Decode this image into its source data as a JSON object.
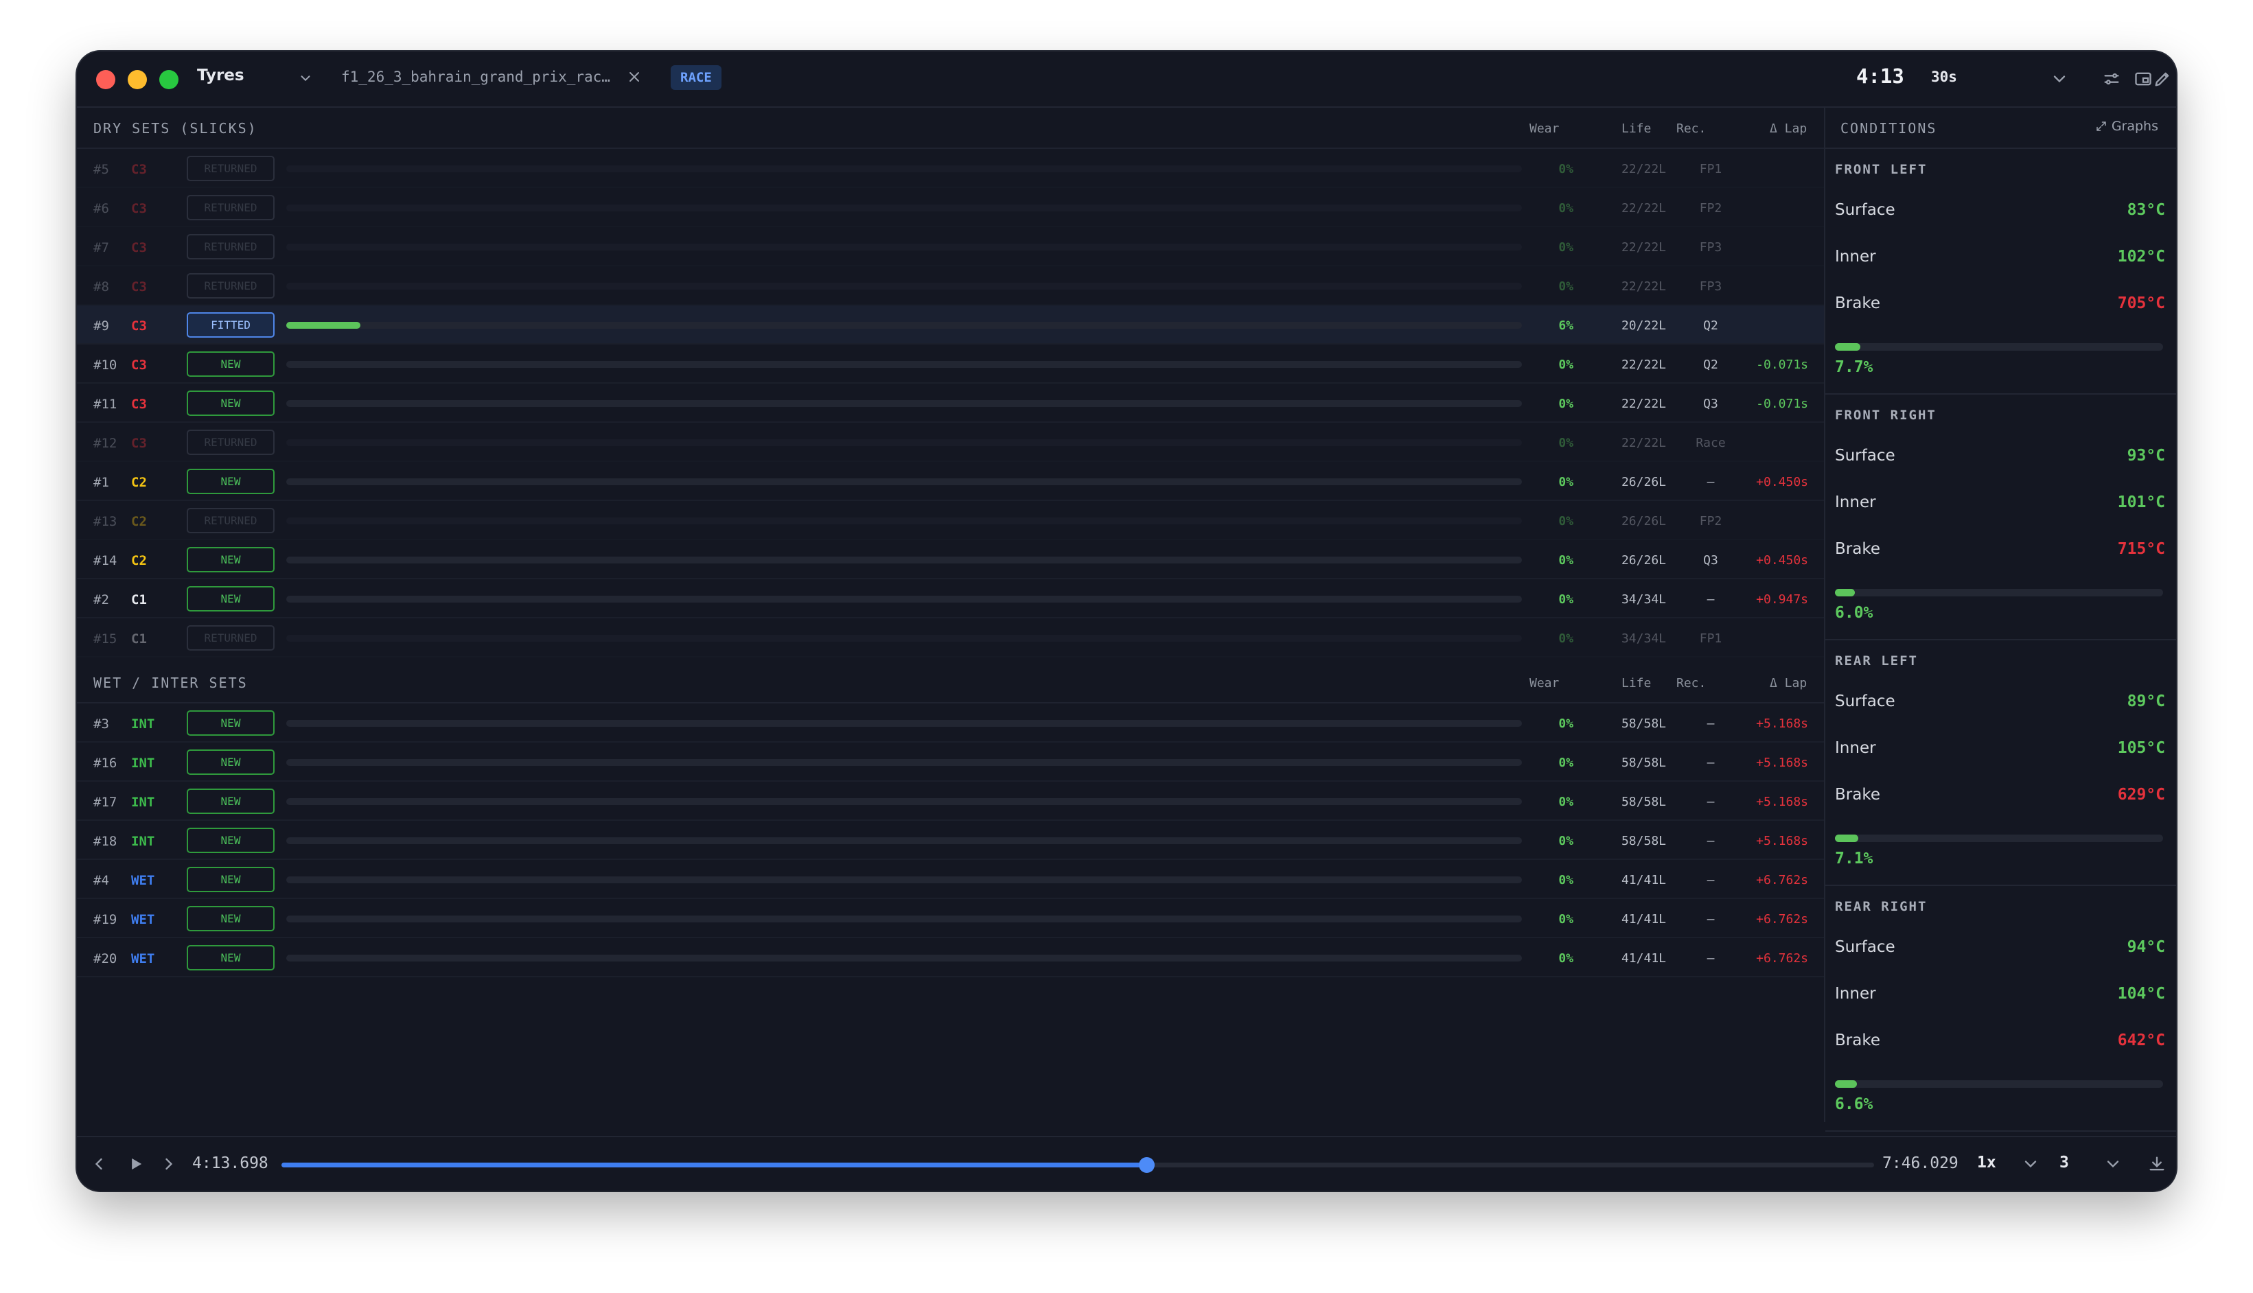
{
  "titlebar": {
    "app_title": "Tyres",
    "file_name": "f1_26_3_bahrain_grand_prix_rac…",
    "session_badge": "RACE",
    "clock": "4:13",
    "interval": "30s"
  },
  "columns": {
    "wear": "Wear",
    "life": "Life",
    "rec": "Rec.",
    "delta": "Δ Lap"
  },
  "dry": {
    "title": "DRY SETS (SLICKS)",
    "rows": [
      {
        "id": "#5",
        "compound": "C3",
        "status": "RETURNED",
        "wear": "0%",
        "life": "22/22L",
        "rec": "FP1",
        "delta": "",
        "wear_fraction": 0
      },
      {
        "id": "#6",
        "compound": "C3",
        "status": "RETURNED",
        "wear": "0%",
        "life": "22/22L",
        "rec": "FP2",
        "delta": "",
        "wear_fraction": 0
      },
      {
        "id": "#7",
        "compound": "C3",
        "status": "RETURNED",
        "wear": "0%",
        "life": "22/22L",
        "rec": "FP3",
        "delta": "",
        "wear_fraction": 0
      },
      {
        "id": "#8",
        "compound": "C3",
        "status": "RETURNED",
        "wear": "0%",
        "life": "22/22L",
        "rec": "FP3",
        "delta": "",
        "wear_fraction": 0
      },
      {
        "id": "#9",
        "compound": "C3",
        "status": "FITTED",
        "wear": "6%",
        "life": "20/22L",
        "rec": "Q2",
        "delta": "",
        "wear_fraction": 0.06
      },
      {
        "id": "#10",
        "compound": "C3",
        "status": "NEW",
        "wear": "0%",
        "life": "22/22L",
        "rec": "Q2",
        "delta": "-0.071s",
        "wear_fraction": 0
      },
      {
        "id": "#11",
        "compound": "C3",
        "status": "NEW",
        "wear": "0%",
        "life": "22/22L",
        "rec": "Q3",
        "delta": "-0.071s",
        "wear_fraction": 0
      },
      {
        "id": "#12",
        "compound": "C3",
        "status": "RETURNED",
        "wear": "0%",
        "life": "22/22L",
        "rec": "Race",
        "delta": "",
        "wear_fraction": 0
      },
      {
        "id": "#1",
        "compound": "C2",
        "status": "NEW",
        "wear": "0%",
        "life": "26/26L",
        "rec": "—",
        "delta": "+0.450s",
        "wear_fraction": 0
      },
      {
        "id": "#13",
        "compound": "C2",
        "status": "RETURNED",
        "wear": "0%",
        "life": "26/26L",
        "rec": "FP2",
        "delta": "",
        "wear_fraction": 0
      },
      {
        "id": "#14",
        "compound": "C2",
        "status": "NEW",
        "wear": "0%",
        "life": "26/26L",
        "rec": "Q3",
        "delta": "+0.450s",
        "wear_fraction": 0
      },
      {
        "id": "#2",
        "compound": "C1",
        "status": "NEW",
        "wear": "0%",
        "life": "34/34L",
        "rec": "—",
        "delta": "+0.947s",
        "wear_fraction": 0
      },
      {
        "id": "#15",
        "compound": "C1",
        "status": "RETURNED",
        "wear": "0%",
        "life": "34/34L",
        "rec": "FP1",
        "delta": "",
        "wear_fraction": 0
      }
    ]
  },
  "wet": {
    "title": "WET / INTER SETS",
    "rows": [
      {
        "id": "#3",
        "compound": "INT",
        "status": "NEW",
        "wear": "0%",
        "life": "58/58L",
        "rec": "—",
        "delta": "+5.168s",
        "wear_fraction": 0
      },
      {
        "id": "#16",
        "compound": "INT",
        "status": "NEW",
        "wear": "0%",
        "life": "58/58L",
        "rec": "—",
        "delta": "+5.168s",
        "wear_fraction": 0
      },
      {
        "id": "#17",
        "compound": "INT",
        "status": "NEW",
        "wear": "0%",
        "life": "58/58L",
        "rec": "—",
        "delta": "+5.168s",
        "wear_fraction": 0
      },
      {
        "id": "#18",
        "compound": "INT",
        "status": "NEW",
        "wear": "0%",
        "life": "58/58L",
        "rec": "—",
        "delta": "+5.168s",
        "wear_fraction": 0
      },
      {
        "id": "#4",
        "compound": "WET",
        "status": "NEW",
        "wear": "0%",
        "life": "41/41L",
        "rec": "—",
        "delta": "+6.762s",
        "wear_fraction": 0
      },
      {
        "id": "#19",
        "compound": "WET",
        "status": "NEW",
        "wear": "0%",
        "life": "41/41L",
        "rec": "—",
        "delta": "+6.762s",
        "wear_fraction": 0
      },
      {
        "id": "#20",
        "compound": "WET",
        "status": "NEW",
        "wear": "0%",
        "life": "41/41L",
        "rec": "—",
        "delta": "+6.762s",
        "wear_fraction": 0
      }
    ]
  },
  "compound_colors": {
    "C3": "#e5323c",
    "C2": "#f3c313",
    "C1": "#e8eaef",
    "INT": "#3dbb4c",
    "WET": "#3f7ef1"
  },
  "status_colors": {
    "positive": "#5dc95e",
    "negative": "#e5323c",
    "accent": "#4d8bf7"
  },
  "conditions": {
    "title": "CONDITIONS",
    "graphs_label": "Graphs",
    "labels": {
      "surface": "Surface",
      "inner": "Inner",
      "brake": "Brake"
    },
    "corners": [
      {
        "name": "FRONT LEFT",
        "surface": "83°C",
        "inner": "102°C",
        "brake": "705°C",
        "wear": "7.7%",
        "wear_fraction": 0.077
      },
      {
        "name": "FRONT RIGHT",
        "surface": "93°C",
        "inner": "101°C",
        "brake": "715°C",
        "wear": "6.0%",
        "wear_fraction": 0.06
      },
      {
        "name": "REAR LEFT",
        "surface": "89°C",
        "inner": "105°C",
        "brake": "629°C",
        "wear": "7.1%",
        "wear_fraction": 0.071
      },
      {
        "name": "REAR RIGHT",
        "surface": "94°C",
        "inner": "104°C",
        "brake": "642°C",
        "wear": "6.6%",
        "wear_fraction": 0.066
      }
    ]
  },
  "playback": {
    "current_time": "4:13.698",
    "end_time": "7:46.029",
    "progress_fraction": 0.543,
    "speed": "1x",
    "laps": "3"
  },
  "icons": [
    "chevron-down-icon",
    "close-icon",
    "sliders-icon",
    "pencil-icon",
    "window-icon",
    "expand-icon",
    "chevron-left-icon",
    "play-icon",
    "chevron-right-icon",
    "download-icon"
  ]
}
